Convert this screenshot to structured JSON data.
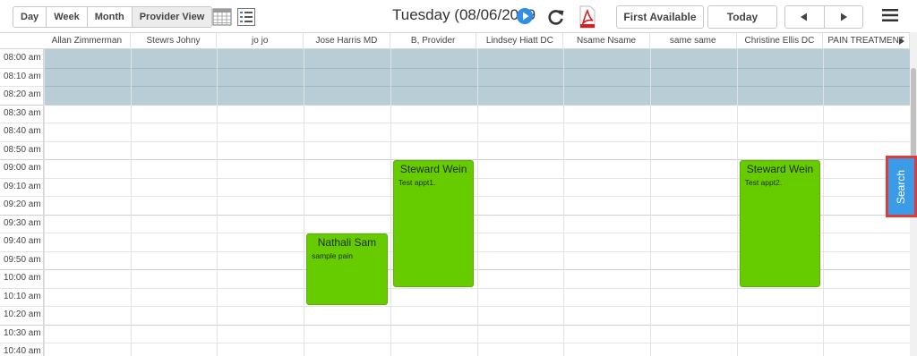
{
  "toolbar": {
    "views": [
      "Day",
      "Week",
      "Month",
      "Provider View"
    ],
    "active_view": "Provider View",
    "date_label": "Tuesday (08/06/2019",
    "first_available_label": "First Available",
    "today_label": "Today"
  },
  "providers": [
    "Allan Zimmerman",
    "Stewrs Johny",
    "jo jo",
    "Jose Harris MD",
    "B, Provider",
    "Lindsey Hiatt DC",
    "Nsame Nsame",
    "same same",
    "Christine Ellis DC",
    "PAIN TREATMENT"
  ],
  "time_slots": [
    "08:00 am",
    "08:10 am",
    "08:20 am",
    "08:30 am",
    "08:40 am",
    "08:50 am",
    "09:00 am",
    "09:10 am",
    "09:20 am",
    "09:30 am",
    "09:40 am",
    "09:50 am",
    "10:00 am",
    "10:10 am",
    "10:20 am",
    "10:30 am",
    "10:40 am"
  ],
  "blocked_slots": [
    "08:00 am",
    "08:10 am",
    "08:20 am"
  ],
  "appointments": [
    {
      "patient": "Nathali Sam",
      "note": "sample pain",
      "provider": "Jose Harris MD",
      "start": "09:40 am",
      "end": "10:20 am"
    },
    {
      "patient": "Steward Wein",
      "note": "Test appt1.",
      "provider": "B, Provider",
      "start": "09:00 am",
      "end": "10:10 am"
    },
    {
      "patient": "Steward Wein",
      "note": "Test appt2.",
      "provider": "Christine Ellis DC",
      "start": "09:00 am",
      "end": "10:10 am"
    }
  ],
  "search_tab": {
    "label": "Search"
  },
  "colors": {
    "appointment": "#66cc00",
    "blocked": "#b8cdd5",
    "search_tab": "#3b9be6",
    "highlight": "#e03a3a"
  },
  "icons": [
    "calendar-grid-icon",
    "list-icon",
    "play-icon",
    "refresh-icon",
    "pdf-icon",
    "arrow-left-icon",
    "arrow-right-icon",
    "hamburger-menu-icon"
  ]
}
